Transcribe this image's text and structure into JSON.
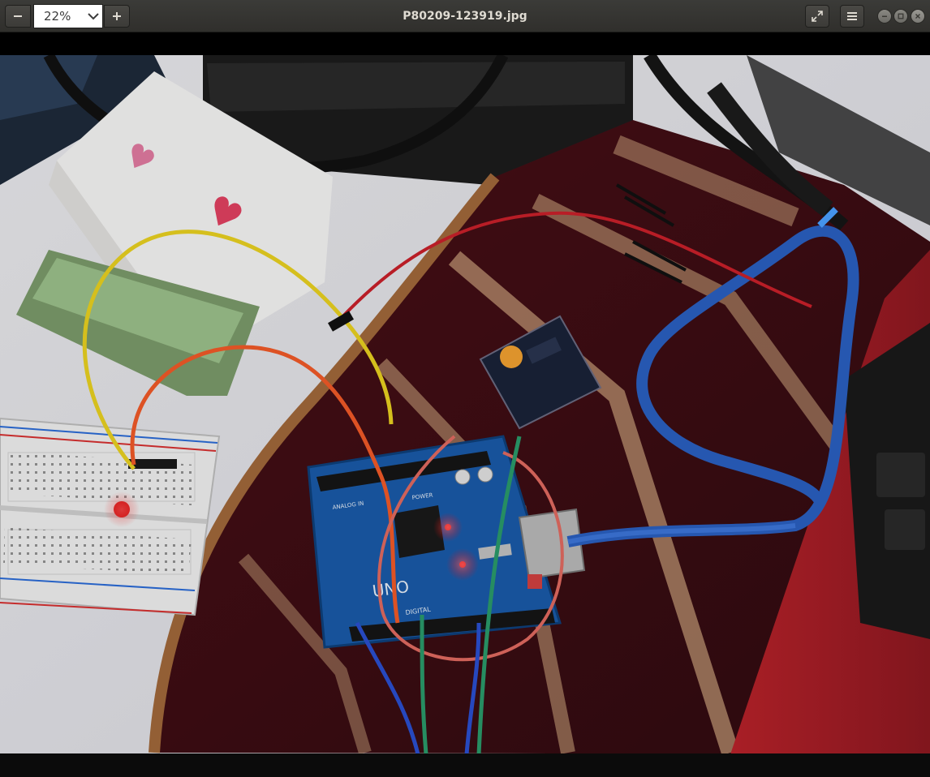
{
  "window": {
    "title": "P80209-123919.jpg"
  },
  "toolbar": {
    "zoom_value": "22%",
    "zoom_out_icon": "minus-icon",
    "zoom_in_icon": "plus-icon",
    "fullscreen_icon": "fullscreen-icon",
    "menu_icon": "hamburger-menu-icon"
  },
  "window_controls": {
    "minimize_icon": "minimize-icon",
    "maximize_icon": "maximize-icon",
    "close_icon": "close-icon"
  },
  "photo": {
    "labels": [
      "UNO",
      "DIGITAL",
      "POWER",
      "ANALOG IN"
    ]
  }
}
